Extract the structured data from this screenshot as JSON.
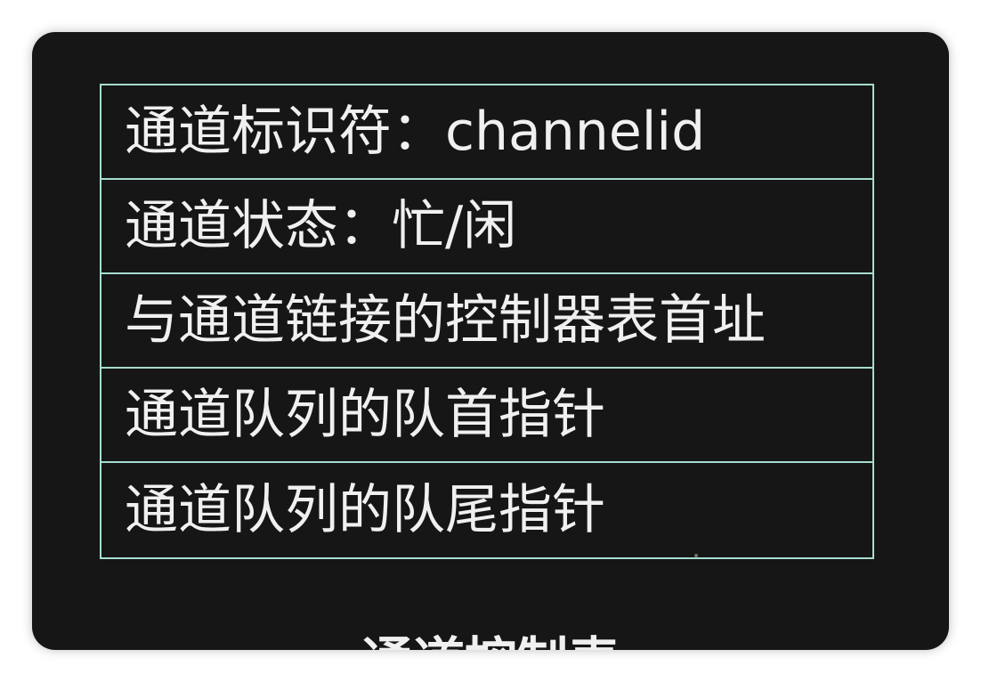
{
  "table": {
    "rows": [
      "通道标识符：channelid",
      "通道状态：忙/闲",
      "与通道链接的控制器表首址",
      "通道队列的队首指针",
      "通道队列的队尾指针"
    ]
  },
  "caption": "通道控制表"
}
